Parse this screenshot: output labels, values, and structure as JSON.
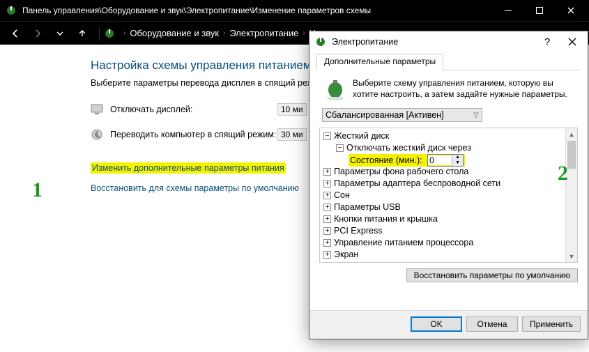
{
  "titlebar": {
    "text": "Панель управления\\Оборудование и звук\\Электропитание\\Изменение параметров схемы"
  },
  "breadcrumb": {
    "items": [
      "Оборудование и звук",
      "Электропитание",
      "Измене"
    ]
  },
  "page": {
    "heading": "Настройка схемы управления питанием \"С",
    "subhead": "Выберите параметры перевода дисплея в спящий реж",
    "displayOff": {
      "label": "Отключать дисплей:",
      "value": "10 ми"
    },
    "sleep": {
      "label": "Переводить компьютер в спящий режим:",
      "value": "30 ми"
    },
    "advLink": "Изменить дополнительные параметры питания",
    "restoreLink": "Восстановить для схемы параметры по умолчанию"
  },
  "annotations": {
    "one": "1",
    "two": "2"
  },
  "dialog": {
    "title": "Электропитание",
    "help": "?",
    "tab": "Дополнительные параметры",
    "hint": "Выберите схему управления питанием, которую вы хотите настроить, а затем задайте нужные параметры.",
    "scheme": "Сбалансированная [Активен]",
    "tree": {
      "hdd": "Жесткий диск",
      "hddOff": "Отключать жесткий диск через",
      "stateLabel": "Состояние (мин.):",
      "stateValue": "0",
      "items": [
        "Параметры фона рабочего стола",
        "Параметры адаптера беспроводной сети",
        "Сон",
        "Параметры USB",
        "Кнопки питания и крышка",
        "PCI Express",
        "Управление питанием процессора",
        "Экран"
      ]
    },
    "restoreDefaults": "Восстановить параметры по умолчанию",
    "buttons": {
      "ok": "OK",
      "cancel": "Отмена",
      "apply": "Применить"
    }
  }
}
